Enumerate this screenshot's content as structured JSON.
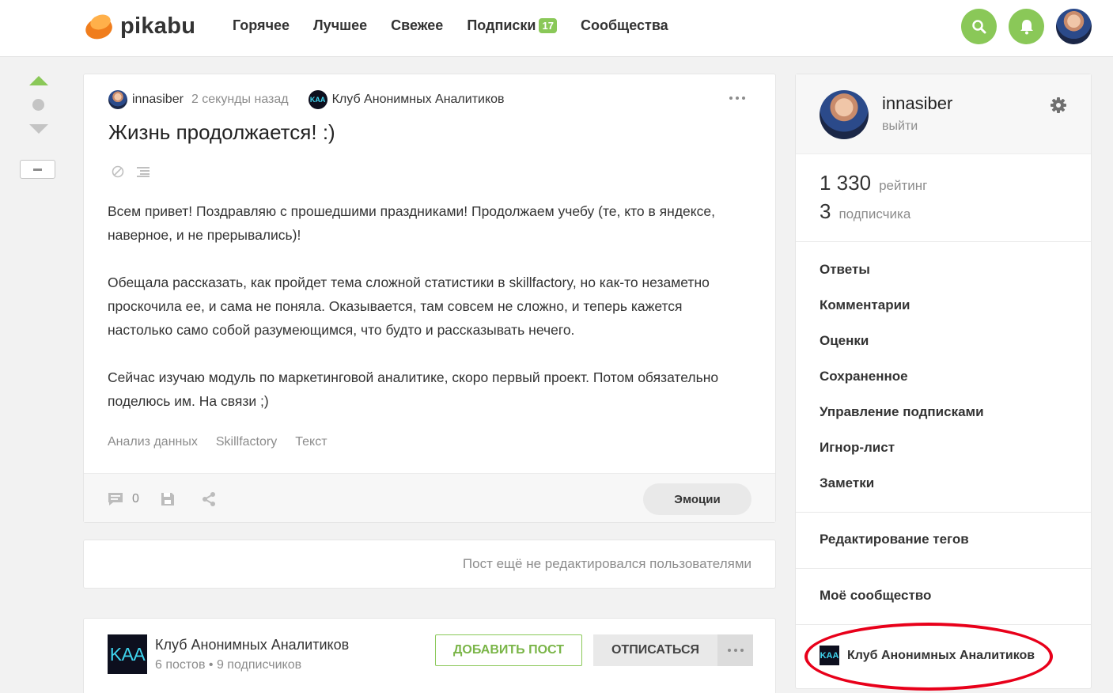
{
  "header": {
    "logo_text": "pikabu",
    "nav": [
      {
        "label": "Горячее"
      },
      {
        "label": "Лучшее"
      },
      {
        "label": "Свежее"
      },
      {
        "label": "Подписки",
        "badge": "17"
      },
      {
        "label": "Сообщества"
      }
    ]
  },
  "post": {
    "author": "innasiber",
    "time": "2 секунды назад",
    "community": "Клуб Анонимных Аналитиков",
    "community_abbr": "KAA",
    "title": "Жизнь продолжается! :)",
    "paragraphs": [
      "Всем привет! Поздравляю с прошедшими праздниками! Продолжаем учебу (те, кто в яндексе, наверное, и не прерывались)!",
      "Обещала рассказать, как пройдет тема сложной статистики в skillfactory, но как-то незаметно проскочила ее, и сама не поняла. Оказывается, там совсем не сложно, и теперь кажется настолько само собой разумеющимся, что будто и рассказывать нечего.",
      "Сейчас изучаю модуль по маркетинговой аналитике, скоро первый проект. Потом обязательно поделюсь им. На связи ;)"
    ],
    "tags": [
      "Анализ данных",
      "Skillfactory",
      "Текст"
    ],
    "comments_count": "0",
    "emotions_label": "Эмоции"
  },
  "edits": {
    "text": "Пост ещё не редактировался пользователями"
  },
  "community_card": {
    "abbr": "KAA",
    "name": "Клуб Анонимных Аналитиков",
    "stats": "6 постов • 9 подписчиков",
    "add_post": "ДОБАВИТЬ ПОСТ",
    "unsubscribe": "ОТПИСАТЬСЯ"
  },
  "sidebar": {
    "username": "innasiber",
    "logout": "выйти",
    "rating_value": "1 330",
    "rating_label": "рейтинг",
    "subs_value": "3",
    "subs_label": "подписчика",
    "menu": [
      "Ответы",
      "Комментарии",
      "Оценки",
      "Сохраненное",
      "Управление подписками",
      "Игнор-лист",
      "Заметки"
    ],
    "edit_tags": "Редактирование тегов",
    "my_community": "Моё сообщество",
    "community_abbr": "KAA",
    "community_name": "Клуб Анонимных Аналитиков"
  },
  "colors": {
    "accent": "#8ac858",
    "highlight": "#e8001a",
    "brand": "#f07d1c"
  }
}
